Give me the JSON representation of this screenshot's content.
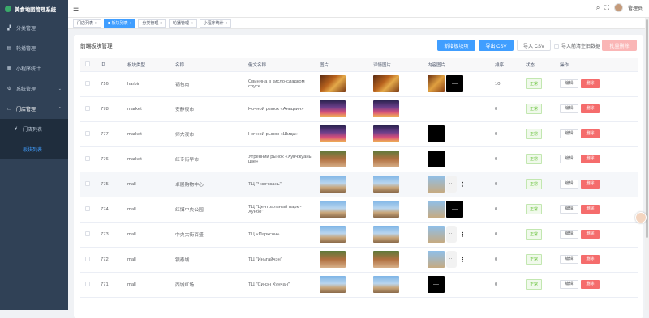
{
  "app": {
    "title": "美食地图管理系统",
    "username": "管理员"
  },
  "sidebar": {
    "items": [
      {
        "label": "分类管理",
        "icon": "category-icon"
      },
      {
        "label": "轮播管理",
        "icon": "carousel-icon"
      },
      {
        "label": "小程序统计",
        "icon": "stats-icon"
      },
      {
        "label": "系统管理",
        "icon": "gear-icon"
      },
      {
        "label": "门店管理",
        "icon": "store-icon"
      }
    ],
    "sub_items": [
      {
        "label": "门店列表",
        "icon": "store-list-icon"
      },
      {
        "label": "板块列表"
      }
    ]
  },
  "tags": [
    {
      "label": "门店列表",
      "active": false
    },
    {
      "label": "板块列表",
      "active": true
    },
    {
      "label": "分类管理",
      "active": false
    },
    {
      "label": "轮播管理",
      "active": false
    },
    {
      "label": "小程序统计",
      "active": false
    }
  ],
  "panel": {
    "title": "前端板块管理",
    "btn_add": "新增板块项",
    "btn_export": "导出 CSV",
    "btn_import": "导入 CSV",
    "import_clear_label": "导入前清空旧数据",
    "btn_batch_delete": "批量删除"
  },
  "table": {
    "headers": [
      "ID",
      "板块类型",
      "名称",
      "俄文名称",
      "图片",
      "详情图片",
      "内容图片",
      "排序",
      "状态",
      "操作"
    ],
    "status_label": "正常",
    "edit_label": "编辑",
    "delete_label": "删除",
    "more_label": "···",
    "rows": [
      {
        "id": "716",
        "type": "harbin",
        "name": "锅包肉",
        "ru_name": "Свинина в кисло-сладком соусе",
        "img": "food",
        "detail": "food",
        "content": [
          "food",
          "black"
        ],
        "sort": "10"
      },
      {
        "id": "778",
        "type": "market",
        "name": "安静夜市",
        "ru_name": "Ночной рынок «Аньцзин»",
        "img": "market",
        "detail": "market",
        "content": [],
        "sort": "0"
      },
      {
        "id": "777",
        "type": "market",
        "name": "师大夜市",
        "ru_name": "Ночной рынок «Шида»",
        "img": "market",
        "detail": "market",
        "content": [
          "black"
        ],
        "sort": "0"
      },
      {
        "id": "776",
        "type": "market",
        "name": "红专街早市",
        "ru_name": "Утренний рынок «Хунчжуань цзе»",
        "img": "street",
        "detail": "street",
        "content": [
          "black"
        ],
        "sort": "0"
      },
      {
        "id": "775",
        "type": "mall",
        "name": "卓展购物中心",
        "ru_name": "ТЦ \"Чжочжань\"",
        "img": "mall",
        "detail": "mall",
        "content": [
          "mall",
          "more"
        ],
        "sort": "0"
      },
      {
        "id": "774",
        "type": "mall",
        "name": "红博中央公园",
        "ru_name": "ТЦ \"Центральный парк - Хунбо\"",
        "img": "mall",
        "detail": "mall",
        "content": [
          "mall",
          "black"
        ],
        "sort": "0"
      },
      {
        "id": "773",
        "type": "mall",
        "name": "中央大街百盛",
        "ru_name": "ТЦ «Парксон»",
        "img": "mall",
        "detail": "mall",
        "content": [
          "mall",
          "more"
        ],
        "sort": "0"
      },
      {
        "id": "772",
        "type": "mall",
        "name": "银泰城",
        "ru_name": "ТЦ \"Иньтайчэн\"",
        "img": "street",
        "detail": "street",
        "content": [
          "mall",
          "more"
        ],
        "sort": "0"
      },
      {
        "id": "771",
        "type": "mall",
        "name": "西城红场",
        "ru_name": "ТЦ \"Сичэн Хунчан\"",
        "img": "mall",
        "detail": "mall",
        "content": [
          "black"
        ],
        "sort": "0"
      }
    ]
  }
}
